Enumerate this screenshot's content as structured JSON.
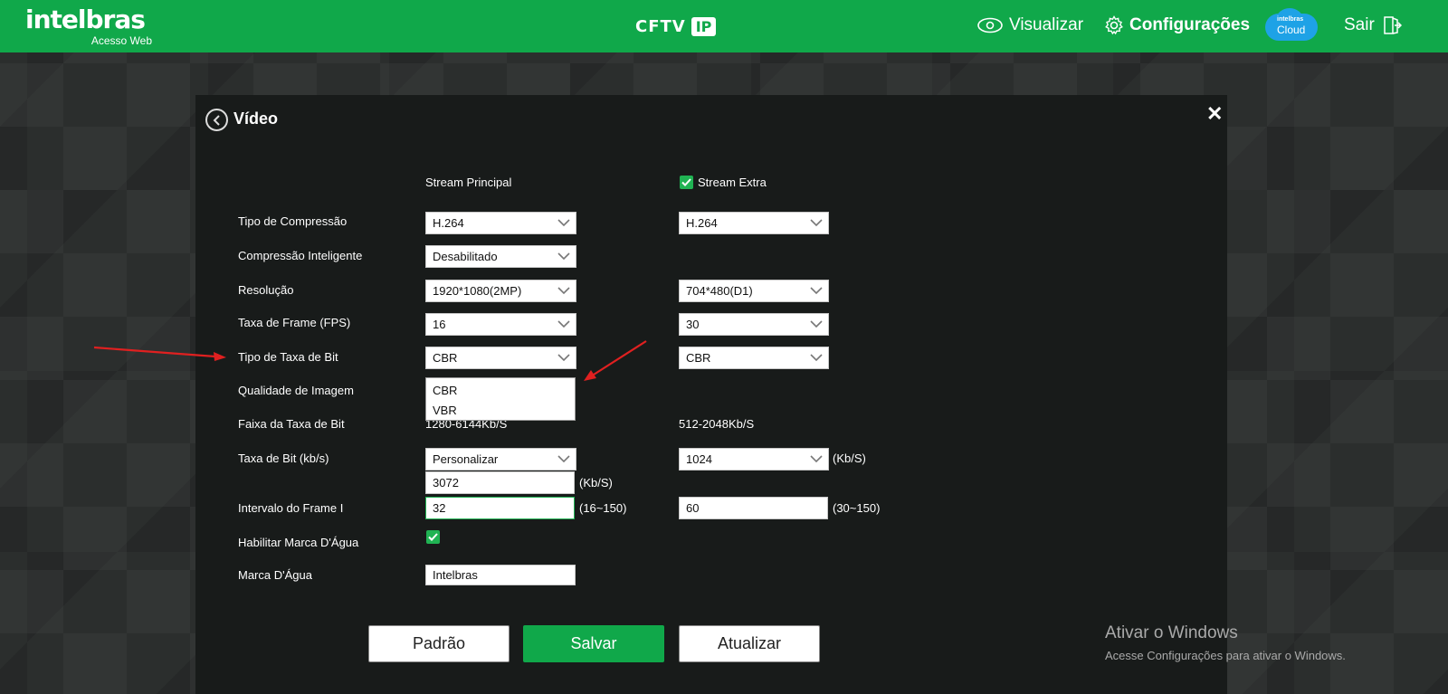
{
  "header": {
    "logo": "intelbras",
    "logo_sub": "Acesso Web",
    "product": "CFTV",
    "product_badge": "IP",
    "nav_view": "Visualizar",
    "nav_config": "Configurações",
    "cloud_top": "intelbras",
    "cloud_label": "Cloud",
    "nav_exit": "Sair",
    "brand_color": "#10a84a"
  },
  "panel": {
    "title": "Vídeo",
    "col_main": "Stream Principal",
    "col_extra": "Stream Extra",
    "extra_enabled": true,
    "rows": {
      "compression_label": "Tipo de Compressão",
      "compression_main": "H.264",
      "compression_extra": "H.264",
      "smart_label": "Compressão Inteligente",
      "smart_main": "Desabilitado",
      "resolution_label": "Resolução",
      "resolution_main": "1920*1080(2MP)",
      "resolution_extra": "704*480(D1)",
      "fps_label": "Taxa de Frame (FPS)",
      "fps_main": "16",
      "fps_extra": "30",
      "bitrate_type_label": "Tipo de Taxa de Bit",
      "bitrate_type_main": "CBR",
      "bitrate_type_extra": "CBR",
      "quality_label": "Qualidade de Imagem",
      "range_label": "Faixa da Taxa de Bit",
      "range_main": "1280-6144Kb/S",
      "range_extra": "512-2048Kb/S",
      "bitrate_label": "Taxa de Bit (kb/s)",
      "bitrate_main": "Personalizar",
      "bitrate_custom": "3072",
      "bitrate_custom_unit": "(Kb/S)",
      "bitrate_extra": "1024",
      "bitrate_extra_unit": "(Kb/S)",
      "iframe_label": "Intervalo do Frame I",
      "iframe_main": "32",
      "iframe_main_range": "(16~150)",
      "iframe_extra": "60",
      "iframe_extra_range": "(30~150)",
      "watermark_enable_label": "Habilitar Marca D'Água",
      "watermark_enabled": true,
      "watermark_label": "Marca D'Água",
      "watermark_value": "Intelbras"
    },
    "dropdown_options": [
      "CBR",
      "VBR"
    ],
    "buttons": {
      "default": "Padrão",
      "save": "Salvar",
      "refresh": "Atualizar"
    }
  },
  "annotations": {
    "arrow_color": "#e02020"
  },
  "watermark_os": {
    "line1": "Ativar o Windows",
    "line2": "Acesse Configurações para ativar o Windows."
  }
}
